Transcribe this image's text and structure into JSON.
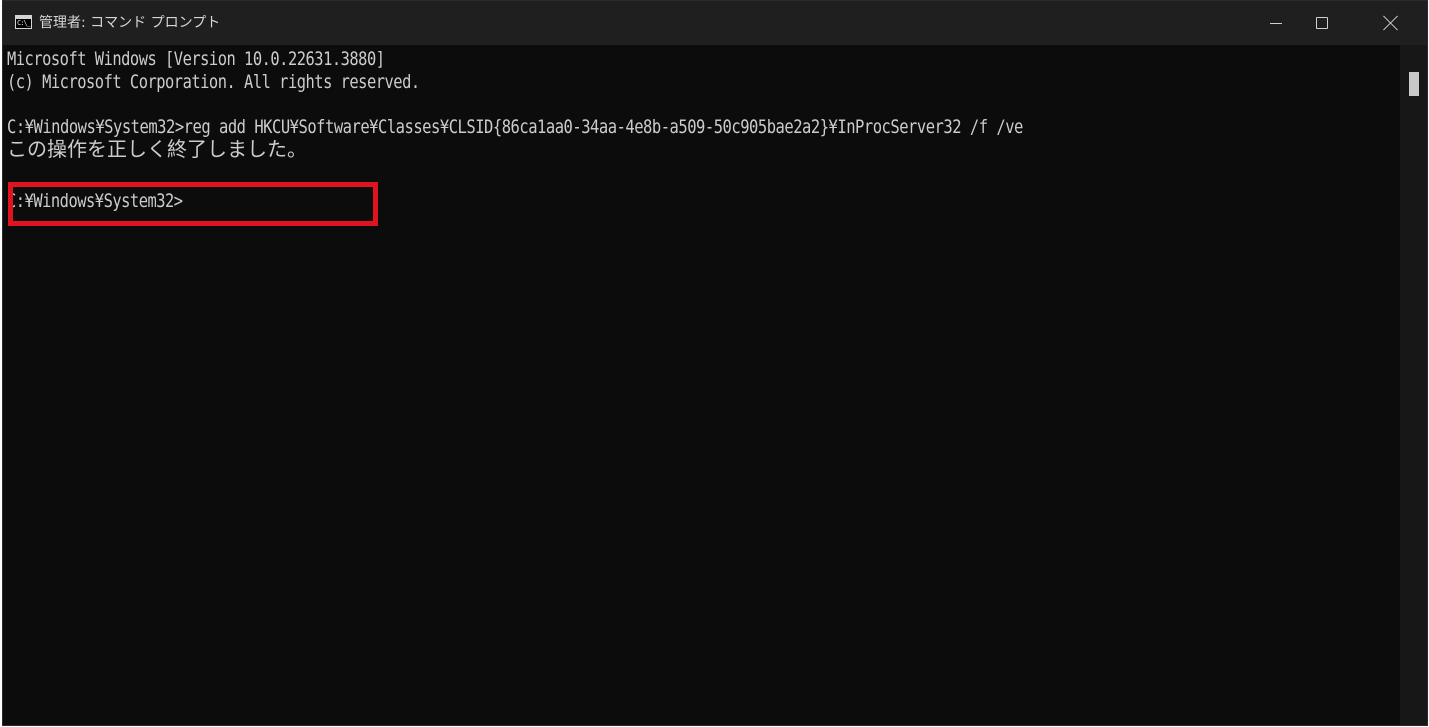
{
  "window": {
    "title": "管理者: コマンド プロンプト",
    "icon": "cmd-icon",
    "icon_text": "C:\\_",
    "controls": {
      "minimize": "minimize-icon",
      "maximize": "maximize-icon",
      "close": "close-icon"
    }
  },
  "console": {
    "lines": [
      "Microsoft Windows [Version 10.0.22631.3880]",
      "(c) Microsoft Corporation. All rights reserved.",
      "C:¥Windows¥System32>reg add HKCU¥Software¥Classes¥CLSID{86ca1aa0-34aa-4e8b-a509-50c905bae2a2}¥InProcServer32 /f /ve",
      "この操作を正しく終了しました。",
      "C:¥Windows¥System32>"
    ]
  },
  "colors": {
    "background": "#0c0c0c",
    "titlebar": "#1f1f1f",
    "text": "#cccccc",
    "highlight": "#e0141e"
  }
}
